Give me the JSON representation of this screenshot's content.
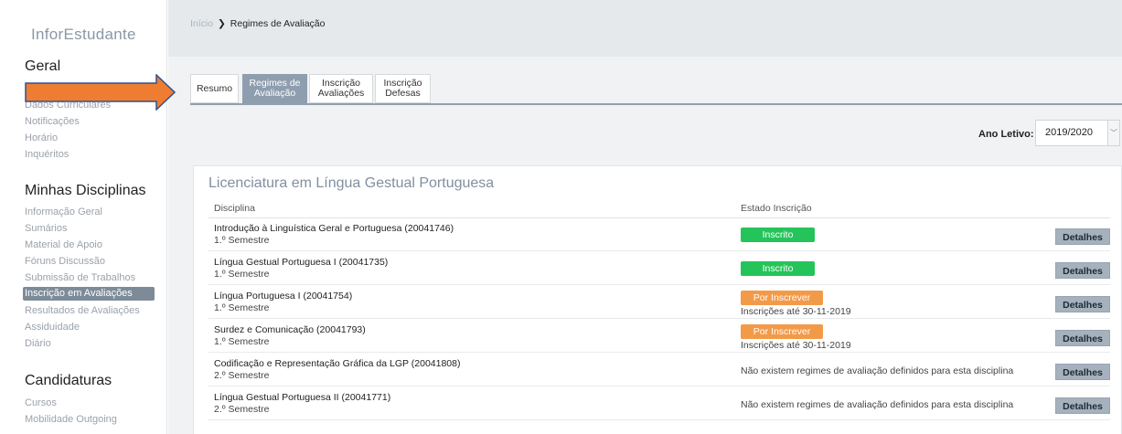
{
  "sidebar": {
    "app_title": "InforEstudante",
    "sections": [
      {
        "title": "Geral",
        "items": [
          "Dados Curriculares",
          "Notificações",
          "Horário",
          "Inquéritos"
        ]
      },
      {
        "title": "Minhas Disciplinas",
        "items": [
          "Informação Geral",
          "Sumários",
          "Material de Apoio",
          "Fóruns Discussão",
          "Submissão de Trabalhos",
          "Inscrição em Avaliações",
          "Resultados de Avaliações",
          "Assiduidade",
          "Diário"
        ],
        "active_item": "Inscrição em Avaliações"
      },
      {
        "title": "Candidaturas",
        "items": [
          "Cursos",
          "Mobilidade Outgoing"
        ]
      }
    ]
  },
  "breadcrumb": {
    "home": "Início",
    "separator": "❯",
    "current": "Regimes de Avaliação"
  },
  "tabs": [
    {
      "label": "Resumo",
      "active": false
    },
    {
      "label": "Regimes de\nAvaliação",
      "active": true
    },
    {
      "label": "Inscrição\nAvaliações",
      "active": false
    },
    {
      "label": "Inscrição\nDefesas",
      "active": false
    }
  ],
  "year_filter": {
    "label": "Ano Letivo:",
    "value": "2019/2020"
  },
  "card": {
    "title": "Licenciatura em Língua Gestual Portuguesa",
    "columns": {
      "discipline": "Disciplina",
      "status": "Estado Inscrição"
    },
    "details_label": "Detalhes",
    "rows": [
      {
        "name": "Introdução à Linguística Geral e Portuguesa (20041746)",
        "semester": "1.º Semestre",
        "status": "Inscrito",
        "status_type": "enrolled",
        "note": ""
      },
      {
        "name": "Língua Gestual Portuguesa I (20041735)",
        "semester": "1.º Semestre",
        "status": "Inscrito",
        "status_type": "enrolled",
        "note": ""
      },
      {
        "name": "Língua Portuguesa I (20041754)",
        "semester": "1.º Semestre",
        "status": "Por Inscrever",
        "status_type": "pending",
        "note": "Inscrições até 30-11-2019"
      },
      {
        "name": "Surdez e Comunicação (20041793)",
        "semester": "1.º Semestre",
        "status": "Por Inscrever",
        "status_type": "pending",
        "note": "Inscrições até 30-11-2019"
      },
      {
        "name": "Codificação e Representação Gráfica da LGP (20041808)",
        "semester": "2.º Semestre",
        "status": "",
        "status_type": "none",
        "note": "Não existem regimes de avaliação definidos para esta disciplina"
      },
      {
        "name": "Língua Gestual Portuguesa II (20041771)",
        "semester": "2.º Semestre",
        "status": "",
        "status_type": "none",
        "note": "Não existem regimes de avaliação definidos para esta disciplina"
      }
    ]
  },
  "colors": {
    "enrolled": "#25c45a",
    "pending": "#f39a49",
    "arrow": "#ee7d31",
    "arrow_border": "#2f528f"
  }
}
